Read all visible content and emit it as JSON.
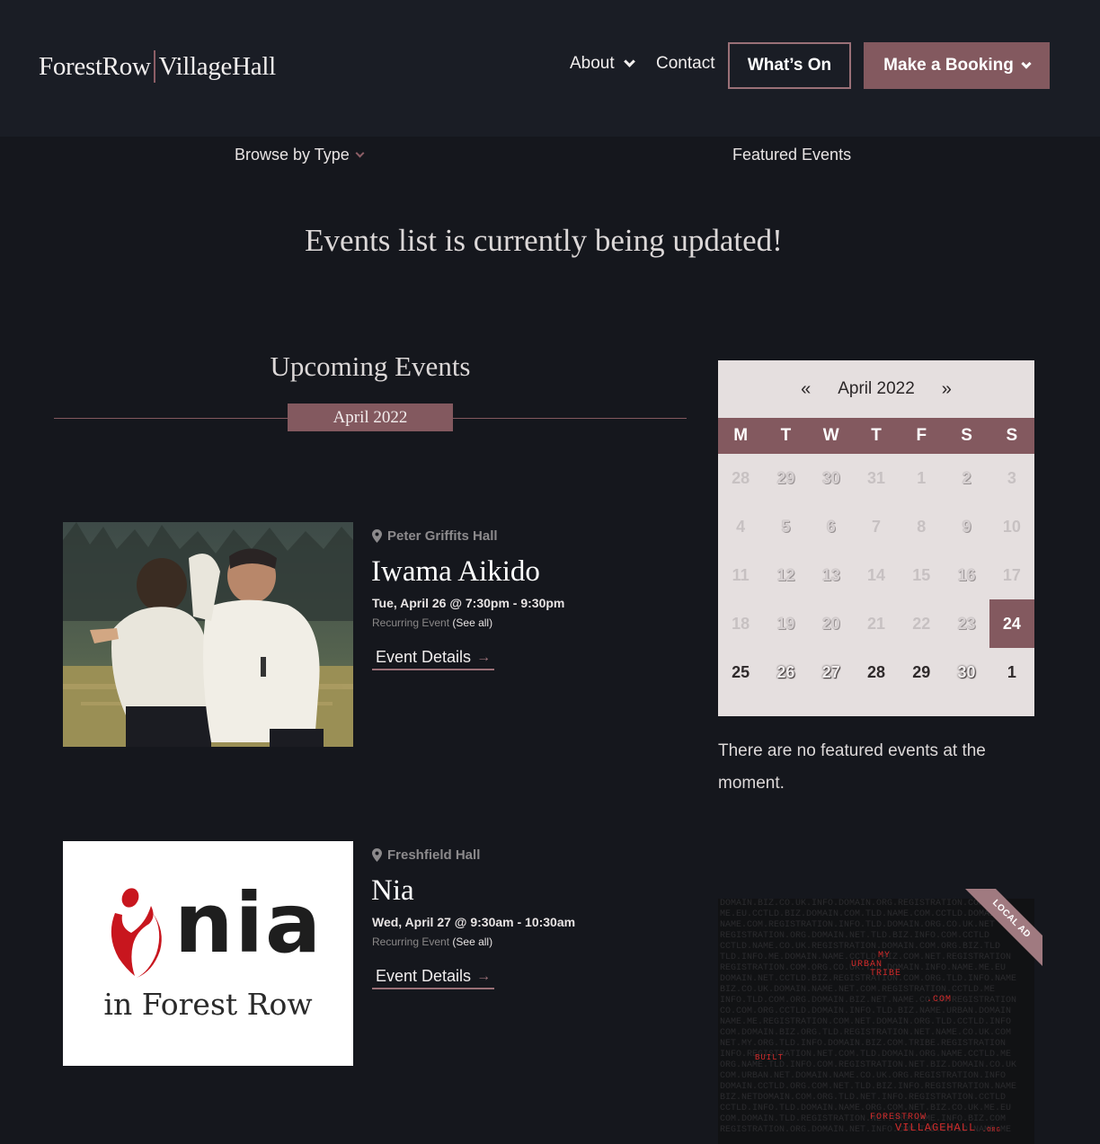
{
  "header": {
    "logo_left": "ForestRow",
    "logo_right": "VillageHall",
    "nav": {
      "about": "About",
      "contact": "Contact",
      "whats_on": "What’s On",
      "make_booking": "Make a Booking"
    }
  },
  "subnav": {
    "browse": "Browse by Type",
    "featured": "Featured Events"
  },
  "notice": "Events list is currently being updated!",
  "upcoming": {
    "title": "Upcoming Events",
    "month": "April 2022"
  },
  "events": [
    {
      "venue": "Peter Griffits Hall",
      "title": "Iwama Aikido",
      "time": "Tue, April 26 @ 7:30pm - 9:30pm",
      "recurring": "Recurring Event",
      "see_all": "(See all)",
      "details": "Event Details"
    },
    {
      "venue": "Freshfield Hall",
      "title": "Nia",
      "time": "Wed, April 27 @ 9:30am - 10:30am",
      "recurring": "Recurring Event",
      "see_all": "(See all)",
      "details": "Event Details",
      "logo_word": "nia",
      "logo_sub": "in Forest Row"
    }
  ],
  "calendar": {
    "prev": "«",
    "month": "April 2022",
    "next": "»",
    "dow": [
      "M",
      "T",
      "W",
      "T",
      "F",
      "S",
      "S"
    ],
    "days": [
      [
        "28",
        "29",
        "30",
        "31",
        "1",
        "2",
        "3"
      ],
      [
        "4",
        "5",
        "6",
        "7",
        "8",
        "9",
        "10"
      ],
      [
        "11",
        "12",
        "13",
        "14",
        "15",
        "16",
        "17"
      ],
      [
        "18",
        "19",
        "20",
        "21",
        "22",
        "23",
        "24"
      ],
      [
        "25",
        "26",
        "27",
        "28",
        "29",
        "30",
        "1"
      ]
    ],
    "today": "24"
  },
  "no_featured": "There are no featured events at the moment.",
  "ad": {
    "ribbon": "LOCAL AD",
    "red_words": [
      "MY",
      "URBAN",
      "TRIBE",
      ".COM",
      "BUILT",
      "FORESTROW",
      "VILLAGEHALL",
      ".ORG"
    ]
  },
  "colors": {
    "accent": "#83595f",
    "background": "#15171d",
    "header": "#1a1d25"
  }
}
